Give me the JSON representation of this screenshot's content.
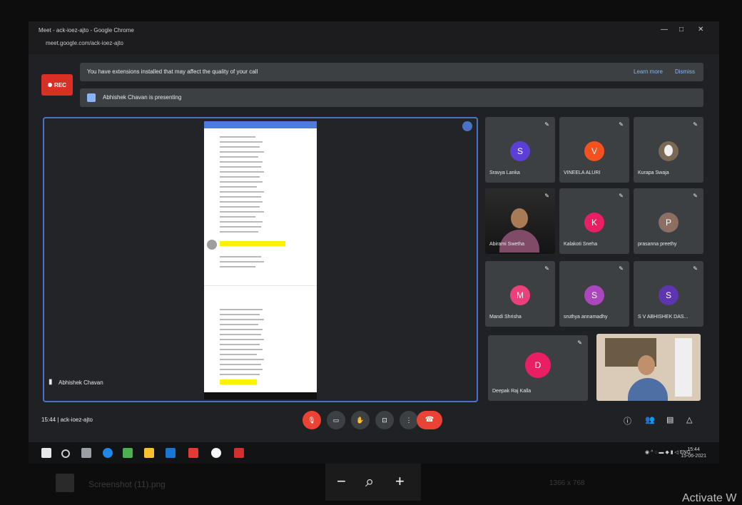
{
  "browser": {
    "title": "Meet - ack-ioez-ajto - Google Chrome",
    "url": "meet.google.com/ack-ioez-ajto"
  },
  "recording": {
    "label": "REC",
    "color": "#d93025"
  },
  "notice": {
    "text": "You have extensions installed that may affect the quality of your call",
    "learn_more": "Learn more",
    "dismiss": "Dismiss"
  },
  "presenting": {
    "text": "Abhishek Chavan is presenting"
  },
  "presenter_tile": {
    "name": "Abhishek Chavan",
    "border_color": "#4a73c8"
  },
  "participants": [
    {
      "name": "Sravya Lanka",
      "initial": "S",
      "color": "#5b3fd6"
    },
    {
      "name": "VINEELA ALURI",
      "initial": "V",
      "color": "#f4511e"
    },
    {
      "name": "Kurapa Swaja",
      "initial": "",
      "color": "#7a6a55",
      "photo": true
    },
    {
      "name": "Abirami Swetha",
      "initial": "",
      "color": "#222222",
      "video": true
    },
    {
      "name": "Kalakoti Sneha",
      "initial": "K",
      "color": "#e91e63"
    },
    {
      "name": "prasanna preethy",
      "initial": "P",
      "color": "#8d6e63"
    },
    {
      "name": "Mandi Shrisha",
      "initial": "M",
      "color": "#ec407a"
    },
    {
      "name": "sruthya annamadhy",
      "initial": "S",
      "color": "#ab47bc"
    },
    {
      "name": "S V ABHISHEK DAS...",
      "initial": "S",
      "color": "#5e35b1"
    },
    {
      "name": "Deepak Raj Kalla",
      "initial": "D",
      "color": "#e91e63"
    }
  ],
  "meeting": {
    "time": "15:44",
    "code": "ack-ioez-ajto"
  },
  "controls": {
    "mic": "mic",
    "camera": "cam",
    "hand": "hand",
    "present": "present",
    "more": "more",
    "end": "end-call"
  },
  "clock": {
    "time": "15:44",
    "date": "15-06-2021"
  },
  "viewer": {
    "filename": "Screenshot (11).png",
    "size_info": "1366 x 768",
    "activate": "Activate W"
  }
}
